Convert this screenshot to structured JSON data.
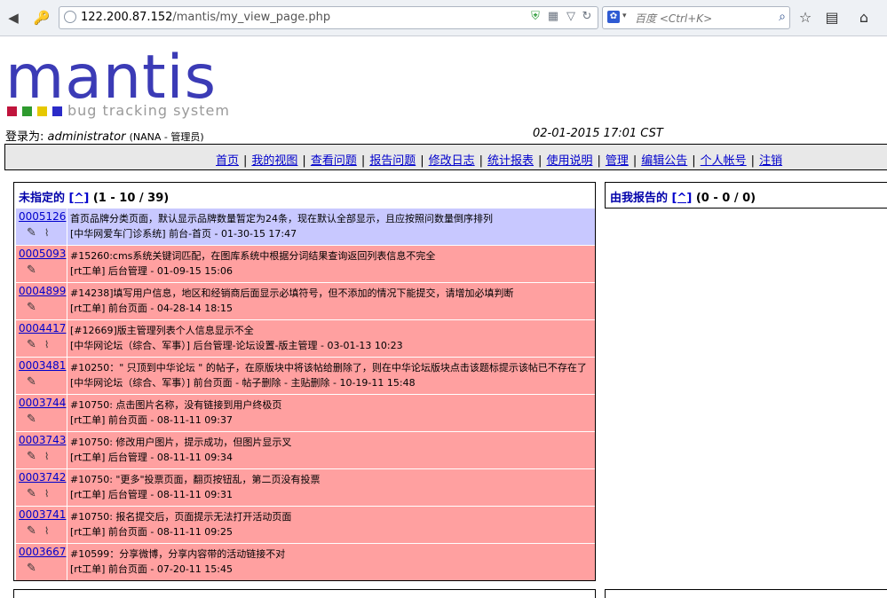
{
  "browser": {
    "url_host": "122.200.87.152",
    "url_path": "/mantis/my_view_page.php",
    "search_placeholder": "百度 <Ctrl+K>"
  },
  "logo": {
    "word": "mantis",
    "tagline": "bug tracking system",
    "colors": [
      "#c0143c",
      "#2e9a2e",
      "#e6c800",
      "#2b2bc8"
    ]
  },
  "login": {
    "prefix": "登录为:",
    "user": "administrator",
    "role": "(NANA - 管理员)"
  },
  "datetime": "02-01-2015 17:01 CST",
  "menu": [
    "首页",
    "我的视图",
    "查看问题",
    "报告问题",
    "修改日志",
    "统计报表",
    "使用说明",
    "管理",
    "编辑公告",
    "个人帐号",
    "注销"
  ],
  "unassigned": {
    "title": "未指定的",
    "caret": "[^]",
    "count": "(1 - 10 / 39)",
    "rows": [
      {
        "id": "0005126",
        "summary": "首页品牌分类页面，默认显示品牌数量暂定为24条，现在默认全部显示，且应按照问数量倒序排列",
        "meta": "[中华网爱车门诊系统] 前台-首页 - 01-30-15 17:47",
        "color": "blue",
        "attach": true
      },
      {
        "id": "0005093",
        "summary": "#15260:cms系统关键词匹配，在图库系统中根据分词结果查询返回列表信息不完全",
        "meta": "[rt工单] 后台管理 - 01-09-15 15:06",
        "color": "red",
        "attach": false
      },
      {
        "id": "0004899",
        "summary": "#14238]填写用户信息，地区和经销商后面显示必填符号，但不添加的情况下能提交，请增加必填判断",
        "meta": "[rt工单] 前台页面 - 04-28-14 18:15",
        "color": "red",
        "attach": false
      },
      {
        "id": "0004417",
        "summary": "[#12669]版主管理列表个人信息显示不全",
        "meta": "[中华网论坛（综合、军事）] 后台管理-论坛设置-版主管理 - 03-01-13 10:23",
        "color": "red",
        "attach": true
      },
      {
        "id": "0003481",
        "summary": "#10250：\" 只顶到中华论坛 \" 的帖子，在原版块中将该帖给删除了，则在中华论坛版块点击该题标提示该帖已不存在了",
        "meta": "[中华网论坛（综合、军事）] 前台页面 - 帖子删除 - 主贴删除 - 10-19-11 15:48",
        "color": "red",
        "attach": false
      },
      {
        "id": "0003744",
        "summary": "#10750: 点击图片名称，没有链接到用户终极页",
        "meta": "[rt工单] 前台页面 - 08-11-11 09:37",
        "color": "red",
        "attach": false
      },
      {
        "id": "0003743",
        "summary": "#10750: 修改用户图片，提示成功，但图片显示叉",
        "meta": "[rt工单] 后台管理 - 08-11-11 09:34",
        "color": "red",
        "attach": true
      },
      {
        "id": "0003742",
        "summary": "#10750: \"更多\"投票页面，翻页按钮乱，第二页没有投票",
        "meta": "[rt工单] 后台管理 - 08-11-11 09:31",
        "color": "red",
        "attach": true
      },
      {
        "id": "0003741",
        "summary": "#10750: 报名提交后，页面提示无法打开活动页面",
        "meta": "[rt工单] 前台页面 - 08-11-11 09:25",
        "color": "red",
        "attach": true
      },
      {
        "id": "0003667",
        "summary": "#10599：分享微博，分享内容带的活动链接不对",
        "meta": "[rt工单] 前台页面 - 07-20-11 15:45",
        "color": "red",
        "attach": false
      }
    ]
  },
  "reported": {
    "title": "由我报告的",
    "caret": "[^]",
    "count": "(0 - 0 / 0)"
  }
}
